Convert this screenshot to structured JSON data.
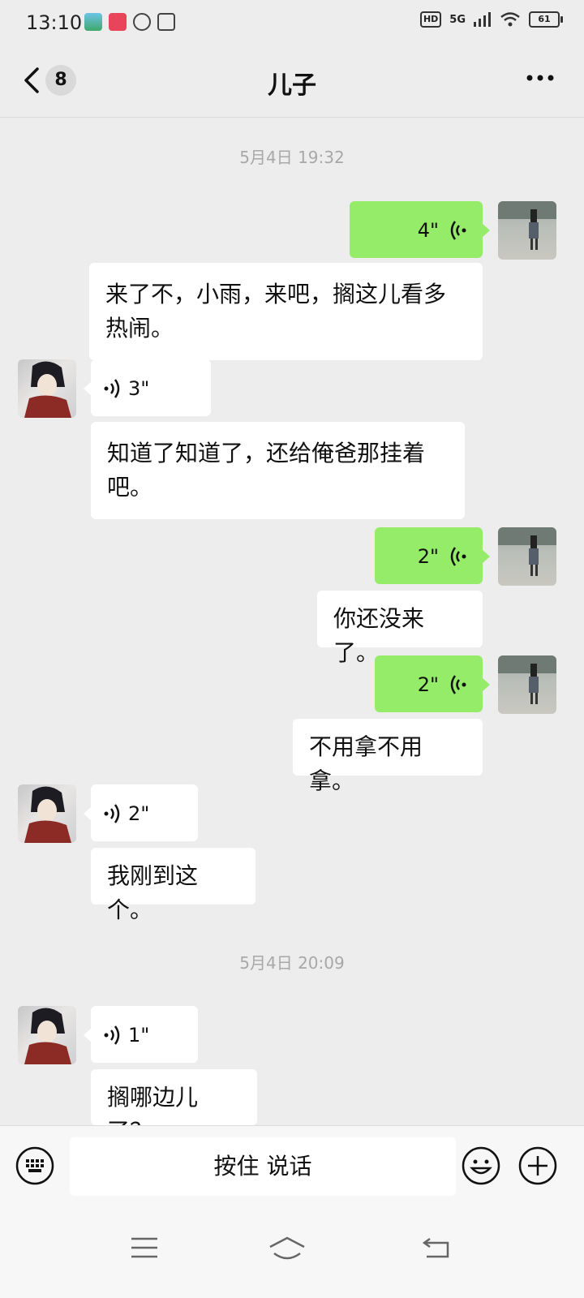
{
  "status_bar": {
    "time": "13:10",
    "network": "5G",
    "battery": "61",
    "hd": "HD"
  },
  "header": {
    "unread_count": "8",
    "title": "儿子"
  },
  "timestamps": [
    "5月4日 19:32",
    "5月4日 20:09"
  ],
  "messages": [
    {
      "side": "right",
      "type": "voice",
      "duration": "4\""
    },
    {
      "side": "right",
      "type": "text",
      "lines": [
        "来了不，小雨，来吧，搁这儿看多",
        "热闹。"
      ]
    },
    {
      "side": "left",
      "type": "voice",
      "duration": "3\""
    },
    {
      "side": "left",
      "type": "text",
      "lines": [
        "知道了知道了，还给俺爸那挂着",
        "吧。"
      ]
    },
    {
      "side": "right",
      "type": "voice",
      "duration": "2\""
    },
    {
      "side": "right",
      "type": "text",
      "lines": [
        "你还没来了。"
      ]
    },
    {
      "side": "right",
      "type": "voice",
      "duration": "2\""
    },
    {
      "side": "right",
      "type": "text",
      "lines": [
        "不用拿不用拿。"
      ]
    },
    {
      "side": "left",
      "type": "voice",
      "duration": "2\""
    },
    {
      "side": "left",
      "type": "text",
      "lines": [
        "我刚到这个。"
      ]
    },
    {
      "side": "left",
      "type": "voice",
      "duration": "1\""
    },
    {
      "side": "left",
      "type": "text",
      "lines": [
        "搁哪边儿了？"
      ]
    }
  ],
  "input_bar": {
    "hold_to_talk_label": "按住 说话"
  },
  "icons": {
    "back": "chevron-left-icon",
    "more": "more-dots-icon",
    "keyboard": "keyboard-icon",
    "emoji": "emoji-icon",
    "plus": "plus-circle-icon",
    "voice": "voice-wave-icon",
    "nav_menu": "menu-icon",
    "nav_home": "home-icon",
    "nav_back": "back-icon"
  },
  "colors": {
    "background": "#ededed",
    "self_bubble": "#95ec69",
    "other_bubble": "#ffffff",
    "timestamp": "#a8a8a8"
  }
}
